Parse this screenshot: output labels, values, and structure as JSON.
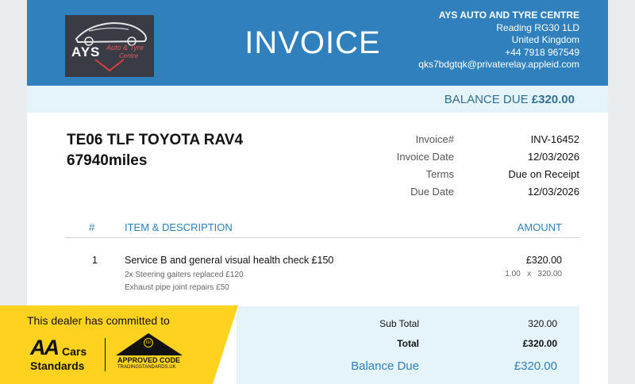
{
  "header": {
    "logo_text": "AYS",
    "logo_sub1": "Auto & Tyre",
    "logo_sub2": "Centre",
    "title": "INVOICE",
    "company_name": "AYS AUTO AND TYRE CENTRE",
    "address_line": "Reading RG30 1LD",
    "country": "United Kingdom",
    "phone": "+44 7918 967549",
    "email": "qks7bdgtqk@privaterelay.appleid.com"
  },
  "balance": {
    "label": "BALANCE DUE",
    "amount": "£320.00"
  },
  "vehicle": {
    "line1": "TE06 TLF TOYOTA RAV4",
    "line2": "67940miles"
  },
  "meta": [
    {
      "label": "Invoice#",
      "value": "INV-16452"
    },
    {
      "label": "Invoice Date",
      "value": "12/03/2026"
    },
    {
      "label": "Terms",
      "value": "Due on Receipt"
    },
    {
      "label": "Due Date",
      "value": "12/03/2026"
    }
  ],
  "table": {
    "headers": {
      "num": "#",
      "item": "ITEM & DESCRIPTION",
      "amount": "AMOUNT"
    },
    "rows": [
      {
        "num": "1",
        "item": "Service B and general visual health check £150",
        "desc1": "2x Steering gaiters replaced £120",
        "desc2": "Exhaust pipe joint repairs £50",
        "amount": "£320.00",
        "qty": "1.00",
        "times": "x",
        "rate": "320.00"
      }
    ]
  },
  "totals": {
    "subtotal_label": "Sub Total",
    "subtotal_value": "320.00",
    "total_label": "Total",
    "total_value": "£320.00",
    "balance_label": "Balance Due",
    "balance_value": "£320.00"
  },
  "badge": {
    "committed_text": "This dealer has committed to",
    "aa_main": "AA",
    "aa_cars": "Cars",
    "aa_standards": "Standards",
    "tsi": "tsi",
    "approved_code": "APPROVED CODE",
    "approved_site": "TRADINGSTANDARDS.UK"
  },
  "colors": {
    "header_blue": "#2f80bd",
    "light_blue": "#e5f3fa",
    "badge_yellow": "#ffd21f"
  }
}
